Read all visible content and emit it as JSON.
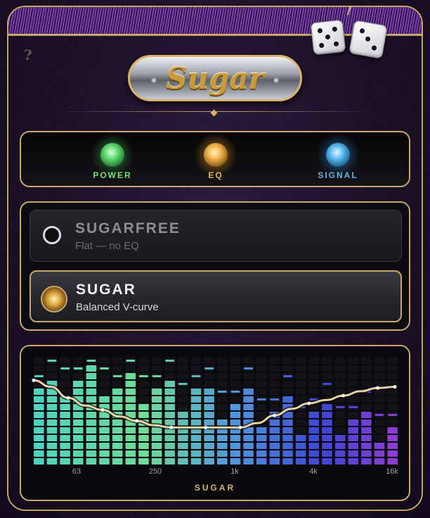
{
  "title": "Sugar",
  "help_glyph": "?",
  "lights": [
    {
      "label": "POWER",
      "color": "#6fe07a"
    },
    {
      "label": "EQ",
      "color": "#e6b54c"
    },
    {
      "label": "SIGNAL",
      "color": "#63b9e8"
    }
  ],
  "presets": [
    {
      "name": "SUGARFREE",
      "desc": "Flat — no EQ",
      "selected": false
    },
    {
      "name": "SUGAR",
      "desc": "Balanced V-curve",
      "selected": true
    }
  ],
  "eq": {
    "name": "SUGAR",
    "freq_labels": [
      "63",
      "250",
      "1k",
      "4k",
      "16k"
    ],
    "curve_points": [
      0.78,
      0.72,
      0.62,
      0.55,
      0.51,
      0.45,
      0.41,
      0.37,
      0.35,
      0.35,
      0.35,
      0.35,
      0.35,
      0.39,
      0.46,
      0.52,
      0.57,
      0.6,
      0.64,
      0.68,
      0.71,
      0.72
    ]
  },
  "colors": {
    "accent_gold": "#c9a86a",
    "fringe_purple": "#7a3fb0"
  }
}
